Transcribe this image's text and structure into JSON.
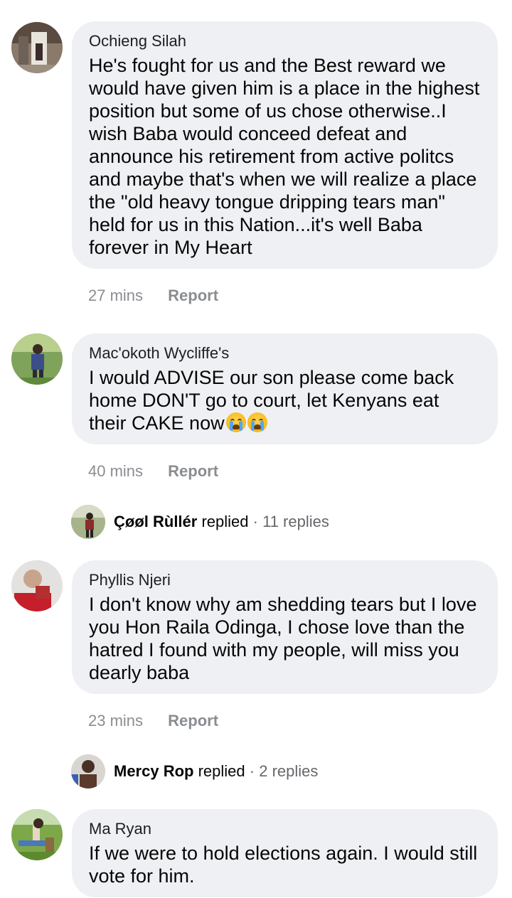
{
  "comments": [
    {
      "author": "Ochieng Silah",
      "text": "He's fought for us and the Best reward we would have given him is a place in the highest position but some of us chose otherwise..I wish Baba would conceed defeat and announce his retirement from active politcs and maybe that's when we will realize a place the \"old heavy tongue dripping tears man\" held for us in this Nation...it's well Baba forever in My Heart",
      "time": "27 mins",
      "report": "Report"
    },
    {
      "author": "Mac'okoth Wycliffe's",
      "text": "I would ADVISE our son please come back home DON'T go to court, let Kenyans eat their CAKE now",
      "emoji": [
        "loudly-crying-face",
        "loudly-crying-face"
      ],
      "time": "40 mins",
      "report": "Report",
      "reply": {
        "name": "Çøøl Rùllér",
        "action": "replied",
        "count": "· 11 replies"
      }
    },
    {
      "author": "Phyllis Njeri",
      "text": "I don't know why am shedding tears but I love you Hon Raila Odinga, I chose love than the hatred I found with my people, will miss you dearly baba",
      "time": "23 mins",
      "report": "Report",
      "reply": {
        "name": "Mercy Rop",
        "action": "replied",
        "count": "· 2 replies"
      }
    },
    {
      "author": "Ma Ryan",
      "text": "If we were to hold elections again. I would still vote for him."
    }
  ],
  "colors": {
    "bubble": "#eef0f3",
    "meta": "#8a8d91",
    "text": "#050505"
  }
}
